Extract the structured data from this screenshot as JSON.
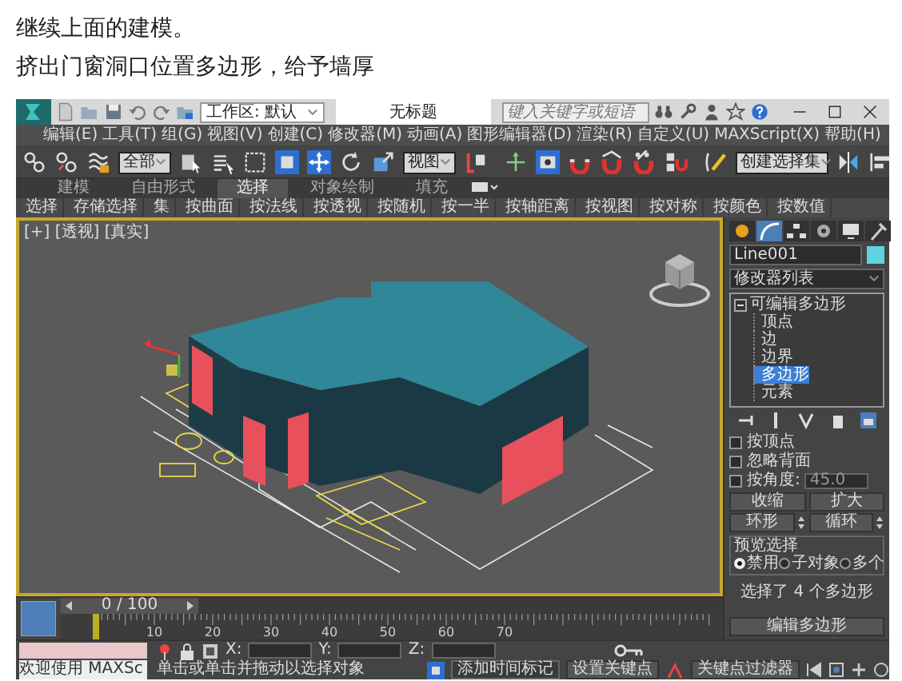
{
  "caption": [
    "继续上面的建模。",
    "挤出门窗洞口位置多边形，给予墙厚"
  ],
  "title_bar": {
    "workspace": "工作区: 默认",
    "title": "无标题",
    "search": {
      "placeholder": "键入关键字或短语"
    }
  },
  "menu": [
    "编辑(E)",
    "工具(T)",
    "组(G)",
    "视图(V)",
    "创建(C)",
    "修改器(M)",
    "动画(A)",
    "图形编辑器(D)",
    "渲染(R)",
    "自定义(U)",
    "MAXScript(X)",
    "帮助(H)"
  ],
  "toolbar": {
    "selection_filter": "全部",
    "reference_coord": "视图",
    "named_selection": "创建选择集"
  },
  "ribbon": {
    "tabs": [
      {
        "label": "建模",
        "selected": false
      },
      {
        "label": "自由形式",
        "selected": false
      },
      {
        "label": "选择",
        "selected": true
      },
      {
        "label": "对象绘制",
        "selected": false
      },
      {
        "label": "填充",
        "selected": false
      }
    ],
    "commands": [
      "选择",
      "存储选择",
      "集",
      "按曲面",
      "按法线",
      "按透视",
      "按随机",
      "按一半",
      "按轴距离",
      "按视图",
      "按对称",
      "按颜色",
      "按数值"
    ]
  },
  "viewport": {
    "label": "[+] [透视] [真实]",
    "active": true
  },
  "command_panel": {
    "object_name": "Line001",
    "modifier_list": "修改器列表",
    "stack": [
      {
        "label": "可编辑多边形",
        "expanded": true,
        "selected": false,
        "children": [
          {
            "label": "顶点",
            "selected": false
          },
          {
            "label": "边",
            "selected": false
          },
          {
            "label": "边界",
            "selected": false
          },
          {
            "label": "多边形",
            "selected": true
          },
          {
            "label": "元素",
            "selected": false
          }
        ]
      }
    ],
    "selection": {
      "options": [
        {
          "label": "按顶点",
          "checked": false
        },
        {
          "label": "忽略背面",
          "checked": false
        },
        {
          "label": "按角度:",
          "checked": false,
          "value": "45.0"
        }
      ],
      "buttons": [
        {
          "label": "收缩",
          "kind": "button"
        },
        {
          "label": "扩大",
          "kind": "button"
        },
        {
          "label": "环形",
          "kind": "spinner"
        },
        {
          "label": "循环",
          "kind": "spinner"
        }
      ],
      "preview": {
        "title": "预览选择",
        "options": [
          {
            "label": "禁用",
            "selected": true
          },
          {
            "label": "子对象",
            "selected": false
          },
          {
            "label": "多个",
            "selected": false
          }
        ]
      },
      "status": "选择了 4 个多边形"
    },
    "next_rollout": "编辑多边形"
  },
  "timeline": {
    "frame": "0 / 100",
    "level": 0,
    "ticks": [
      "10",
      "20",
      "30",
      "40",
      "50",
      "60",
      "70"
    ]
  },
  "status_bar": {
    "listener": "欢迎使用 MAXSc",
    "prompt": "单击或单击并拖动以选择对象",
    "coords": [
      "X:",
      "Y:",
      "Z:"
    ],
    "time_tag": "添加时间标记",
    "set_key": "设置关键点",
    "key_filters": "关键点过滤器"
  }
}
